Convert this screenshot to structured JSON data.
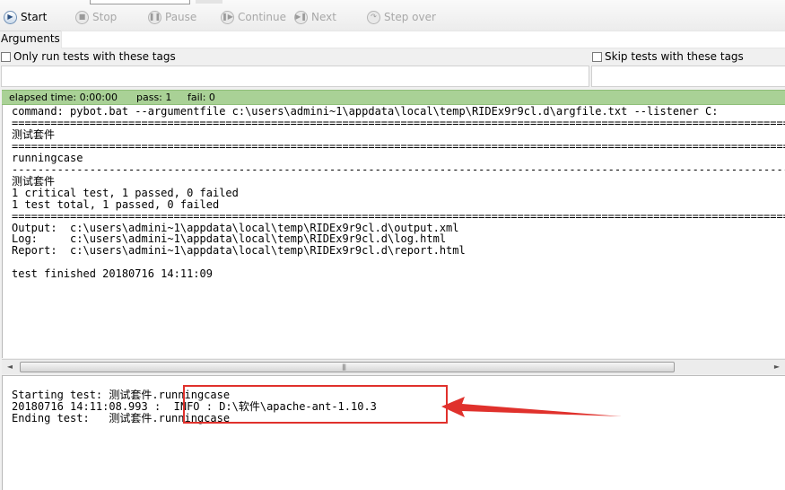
{
  "toolbar": {
    "start": "Start",
    "stop": "Stop",
    "pause": "Pause",
    "continue": "Continue",
    "next": "Next",
    "step_over": "Step over"
  },
  "arguments": {
    "label": "Arguments:",
    "value": ""
  },
  "tags": {
    "only_run_label": "Only run tests with these tags",
    "skip_label": "Skip tests with these tags",
    "only_run_value": "",
    "skip_value": ""
  },
  "status": {
    "elapsed": "elapsed time: 0:00:00",
    "pass": "pass: 1",
    "fail": "fail: 0",
    "color": "#a9d196"
  },
  "console": {
    "lines": [
      "command: pybot.bat --argumentfile c:\\users\\admini~1\\appdata\\local\\temp\\RIDEx9r9cl.d\\argfile.txt --listener C:",
      "==============================================================================================================================",
      "测试套件",
      "==============================================================================================================================",
      "runningcase",
      "------------------------------------------------------------------------------------------------------------------------------",
      "测试套件",
      "1 critical test, 1 passed, 0 failed",
      "1 test total, 1 passed, 0 failed",
      "==============================================================================================================================",
      "Output:  c:\\users\\admini~1\\appdata\\local\\temp\\RIDEx9r9cl.d\\output.xml",
      "Log:     c:\\users\\admini~1\\appdata\\local\\temp\\RIDEx9r9cl.d\\log.html",
      "Report:  c:\\users\\admini~1\\appdata\\local\\temp\\RIDEx9r9cl.d\\report.html",
      "",
      "test finished 20180716 14:11:09"
    ]
  },
  "scrollbar": {
    "left_arrow": "◄",
    "right_arrow": "►"
  },
  "log": {
    "lines": [
      "Starting test: 测试套件.runningcase",
      "20180716 14:11:08.993 :  INFO : D:\\软件\\apache-ant-1.10.3",
      "Ending test:   测试套件.runningcase"
    ]
  },
  "annotation": {
    "color": "#e0312c"
  }
}
